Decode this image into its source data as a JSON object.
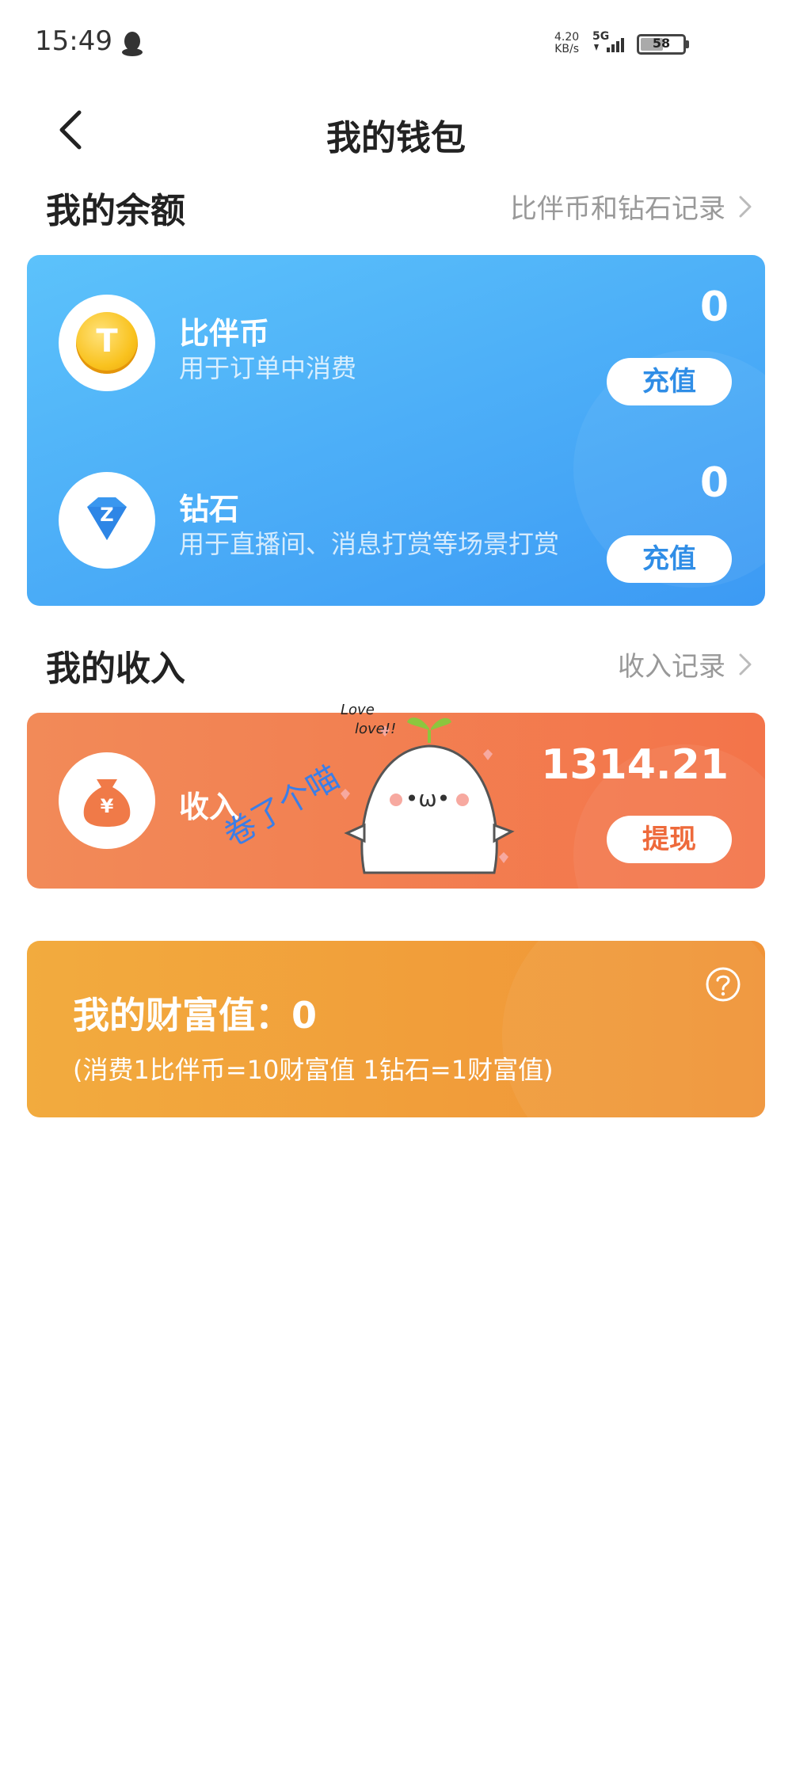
{
  "status_bar": {
    "time": "15:49",
    "net_speed_value": "4.20",
    "net_speed_unit": "KB/s",
    "network_type": "5G",
    "battery_level": "58",
    "battery_fraction": 0.58
  },
  "header": {
    "title": "我的钱包"
  },
  "balance_section": {
    "title": "我的余额",
    "link_label": "比伴币和钻石记录"
  },
  "balance_items": [
    {
      "name": "比伴币",
      "description": "用于订单中消费",
      "amount": "0",
      "button_label": "充值",
      "icon": "coin-icon",
      "icon_letter": "T"
    },
    {
      "name": "钻石",
      "description": "用于直播间、消息打赏等场景打赏",
      "amount": "0",
      "button_label": "充值",
      "icon": "diamond-icon",
      "icon_letter": "Z"
    }
  ],
  "income_section": {
    "title": "我的收入",
    "link_label": "收入记录"
  },
  "income": {
    "name": "收入",
    "amount": "1314.21",
    "button_label": "提现",
    "icon": "money-bag-icon",
    "icon_symbol": "¥"
  },
  "wealth": {
    "label": "我的财富值：0",
    "note": "(消费1比伴币=10财富值 1钻石=1财富值)",
    "help_icon": "question-icon"
  },
  "sticker": {
    "caption": "卷了个喵",
    "love_1": "Love",
    "love_2": "love!!",
    "face": "•ω•"
  },
  "colors": {
    "balance_card": "#4aaef7",
    "income_card": "#f3804f",
    "wealth_card": "#f1a13b",
    "button_blue_text": "#2f8de6",
    "button_orange_text": "#ee6a3b"
  }
}
